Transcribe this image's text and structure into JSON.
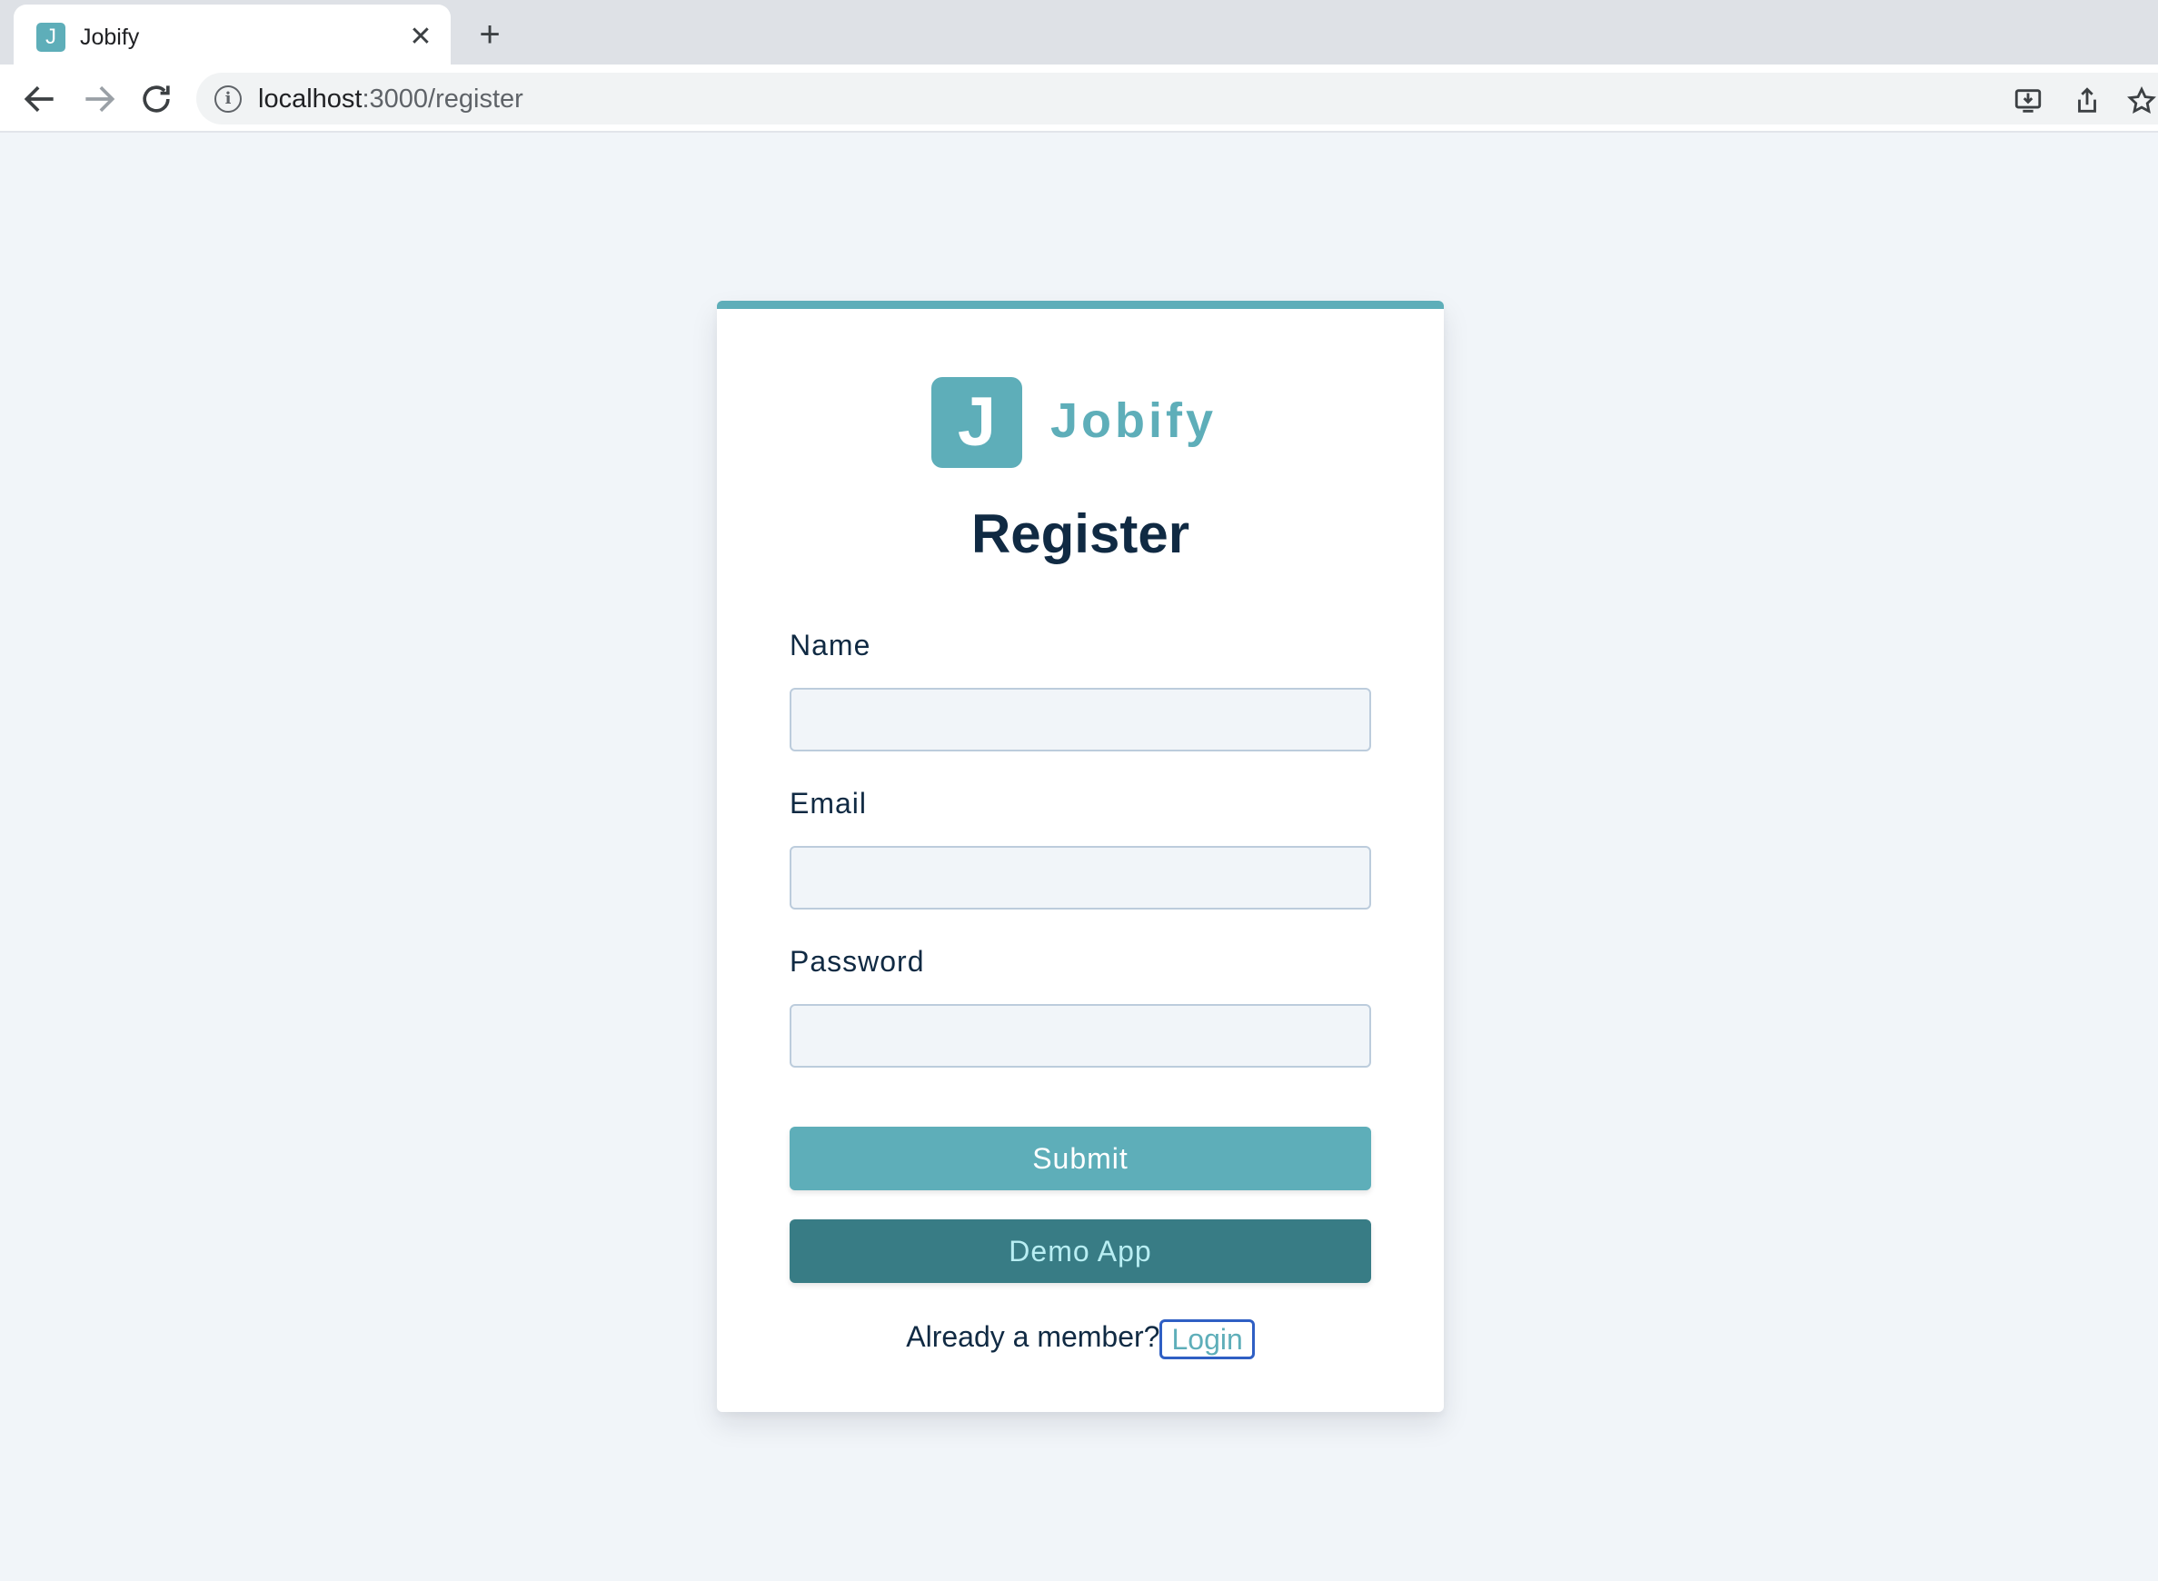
{
  "browser": {
    "tab": {
      "favicon_letter": "J",
      "title": "Jobify"
    },
    "address": {
      "host": "localhost",
      "path": ":3000/register"
    }
  },
  "icons": {
    "back": "arrow-left-icon",
    "forward": "arrow-right-icon",
    "reload": "reload-icon",
    "site_info": "info-icon",
    "install": "install-app-icon",
    "share": "share-icon",
    "bookmark": "star-icon"
  },
  "logo": {
    "letter": "J",
    "text": "Jobify"
  },
  "form": {
    "title": "Register",
    "fields": [
      {
        "label": "Name",
        "value": "",
        "type": "text"
      },
      {
        "label": "Email",
        "value": "",
        "type": "email"
      },
      {
        "label": "Password",
        "value": "",
        "type": "password"
      }
    ],
    "submit_label": "Submit",
    "demo_label": "Demo App",
    "member_text": "Already a member?",
    "login_label": "Login"
  },
  "colors": {
    "brand": "#5eaeb9",
    "brand_dark": "#387c85",
    "text_dark": "#102a43",
    "page_background": "#f1f5f9"
  }
}
